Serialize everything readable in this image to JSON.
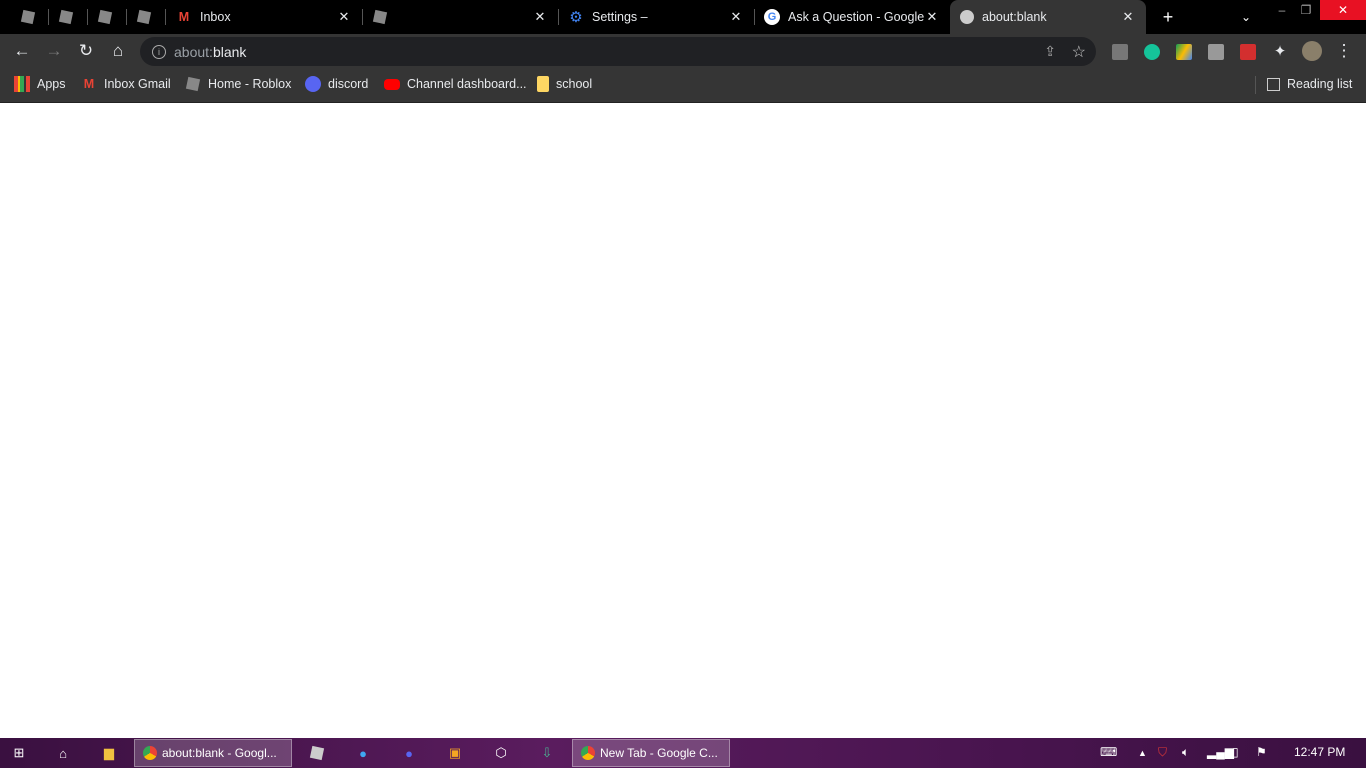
{
  "tabs": [
    {
      "title": "",
      "icon": "roblox-icon",
      "pinned": true
    },
    {
      "title": "",
      "icon": "roblox-icon",
      "pinned": true
    },
    {
      "title": "",
      "icon": "roblox-icon",
      "pinned": true
    },
    {
      "title": "",
      "icon": "roblox-icon",
      "pinned": true
    },
    {
      "title": "Inbox",
      "icon": "gmail-icon"
    },
    {
      "title": "",
      "icon": "roblox-icon"
    },
    {
      "title": "Settings –",
      "icon": "gear-icon"
    },
    {
      "title": "Ask a Question - Google",
      "icon": "google-icon"
    },
    {
      "title": "about:blank",
      "icon": "globe-icon",
      "active": true
    }
  ],
  "omnibox": {
    "prefix": "about:",
    "host": "blank"
  },
  "bookmarks": [
    {
      "label": "Apps",
      "icon": "apps-grid-icon"
    },
    {
      "label": "Inbox Gmail",
      "icon": "gmail-icon"
    },
    {
      "label": "Home - Roblox",
      "icon": "roblox-icon"
    },
    {
      "label": "discord",
      "icon": "discord-icon"
    },
    {
      "label": "Channel dashboard...",
      "icon": "youtube-icon"
    },
    {
      "label": "school",
      "icon": "folder-icon"
    }
  ],
  "reading_list": "Reading list",
  "taskbar": {
    "apps": [
      {
        "label": "about:blank - Googl..."
      },
      {
        "label": "New Tab - Google C..."
      }
    ],
    "clock": "12:47 PM"
  },
  "colors": {
    "tabstrip": "#000000",
    "toolbar": "#353535",
    "omnibox": "#202124",
    "close": "#e81123",
    "taskbar": "#4a1550"
  }
}
